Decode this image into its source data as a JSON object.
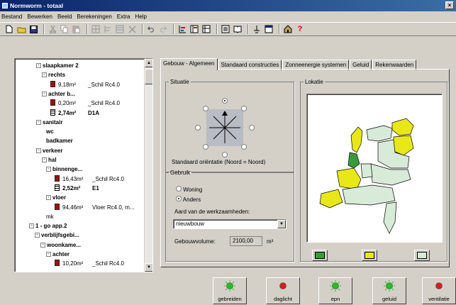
{
  "window": {
    "title": "Normworm - totaal",
    "close_glyph": "×"
  },
  "menu": [
    "Bestand",
    "Bewerken",
    "Beeld",
    "Berekeningen",
    "Extra",
    "Help"
  ],
  "toolbar": [
    "new-icon",
    "open-icon",
    "save-icon",
    "cut-icon",
    "copy-icon",
    "paste-icon",
    "grid-icon",
    "insert-icon",
    "table-icon",
    "delete-icon",
    "undo-icon",
    "redo-icon",
    "layout-icon",
    "layout2-icon",
    "layout3-icon",
    "sheet-icon",
    "book-icon",
    "pin-icon",
    "window-icon",
    "home-icon",
    "help-icon"
  ],
  "tree": [
    {
      "indent": 0,
      "expander": "⊟",
      "icon": "",
      "label": "slaapkamer 2",
      "bold": true
    },
    {
      "indent": 8,
      "expander": "⊟",
      "icon": "",
      "label": "rechts",
      "bold": true
    },
    {
      "indent": 20,
      "expander": "",
      "icon": "wall",
      "area": "9,18m²",
      "construction": "_Schil Rc4.0",
      "bold": false
    },
    {
      "indent": 8,
      "expander": "⊟",
      "icon": "",
      "label": "achter b...",
      "bold": true
    },
    {
      "indent": 20,
      "expander": "",
      "icon": "wall",
      "area": "0,20m²",
      "construction": "_Schil Rc4.0",
      "bold": false
    },
    {
      "indent": 20,
      "expander": "",
      "icon": "window",
      "area": "2,74m²",
      "construction": "D1A",
      "bold": true
    },
    {
      "indent": 0,
      "expander": "⊟",
      "icon": "",
      "label": "sanitair",
      "bold": true
    },
    {
      "indent": 14,
      "expander": "",
      "icon": "",
      "label": "wc",
      "bold": true
    },
    {
      "indent": 14,
      "expander": "",
      "icon": "",
      "label": "badkamer",
      "bold": true
    },
    {
      "indent": 0,
      "expander": "⊟",
      "icon": "",
      "label": "verkeer",
      "bold": true
    },
    {
      "indent": 8,
      "expander": "⊟",
      "icon": "",
      "label": "hal",
      "bold": true
    },
    {
      "indent": 14,
      "expander": "⊟",
      "icon": "",
      "label": "binnenge...",
      "bold": true
    },
    {
      "indent": 26,
      "expander": "",
      "icon": "wall",
      "area": "16,43m²",
      "construction": "_Schil Rc4.0",
      "bold": false
    },
    {
      "indent": 26,
      "expander": "",
      "icon": "window",
      "area": "2,52m²",
      "construction": "E1",
      "bold": true
    },
    {
      "indent": 14,
      "expander": "⊟",
      "icon": "",
      "label": "vloer",
      "bold": true
    },
    {
      "indent": 26,
      "expander": "",
      "icon": "wall",
      "area": "94,46m²",
      "construction": "Vloer Rc4.0, m...",
      "bold": false
    },
    {
      "indent": 14,
      "expander": "",
      "icon": "",
      "label": "mk",
      "bold": false
    },
    {
      "indent": -10,
      "expander": "⊟",
      "icon": "",
      "label": "1 - go app.2",
      "bold": true
    },
    {
      "indent": -2,
      "expander": "⊟",
      "icon": "",
      "label": "verblijfsgebi...",
      "bold": true
    },
    {
      "indent": 6,
      "expander": "⊟",
      "icon": "",
      "label": "woonkame...",
      "bold": true
    },
    {
      "indent": 14,
      "expander": "⊟",
      "icon": "",
      "label": "achter",
      "bold": true
    },
    {
      "indent": 26,
      "expander": "",
      "icon": "wall",
      "area": "10,20m²",
      "construction": "_Schil Rc4.0",
      "bold": false
    }
  ],
  "tabs": [
    "Gebouw - Algemeen",
    "Standaard constructies",
    "Zonneenergie systemen",
    "Geluid",
    "Rekenwaarden"
  ],
  "situatie": {
    "legend": "Situatie",
    "caption": "Standaard oriëntatie (Noord = Noord)"
  },
  "gebruik": {
    "legend": "Gebruik",
    "options": [
      "Woning",
      "Anders"
    ],
    "selected": 1,
    "work_label": "Aard van de werkzaamheden:",
    "work_value": "nieuwbouw",
    "volume_label": "Gebouwvolume:",
    "volume_value": "2100,00",
    "volume_unit": "m³"
  },
  "lokatie": {
    "legend": "Lokatie"
  },
  "colors": {
    "yellow": "#e8e818",
    "light_green": "#d8ead8",
    "dark_green": "#3a9a3a",
    "red_light": "#d42020",
    "green_light": "#20c020"
  },
  "map_regions": [
    {
      "name": "noord-holland-north",
      "color": "yellow"
    },
    {
      "name": "friesland",
      "color": "light_green"
    },
    {
      "name": "groningen",
      "color": "yellow"
    },
    {
      "name": "drenthe",
      "color": "yellow"
    },
    {
      "name": "overijssel",
      "color": "light_green"
    },
    {
      "name": "gelderland",
      "color": "light_green"
    },
    {
      "name": "utrecht",
      "color": "light_green"
    },
    {
      "name": "noord-holland-south",
      "color": "dark_green"
    },
    {
      "name": "zuid-holland",
      "color": "yellow"
    },
    {
      "name": "zeeland",
      "color": "yellow"
    },
    {
      "name": "noord-brabant",
      "color": "light_green"
    },
    {
      "name": "limburg",
      "color": "light_green"
    }
  ],
  "status_buttons": [
    {
      "label": "gebreiden",
      "state": "green"
    },
    {
      "label": "daglicht",
      "state": "red"
    },
    {
      "label": "epn",
      "state": "green"
    },
    {
      "label": "geluid",
      "state": "green"
    },
    {
      "label": "ventilatie",
      "state": "red"
    }
  ]
}
